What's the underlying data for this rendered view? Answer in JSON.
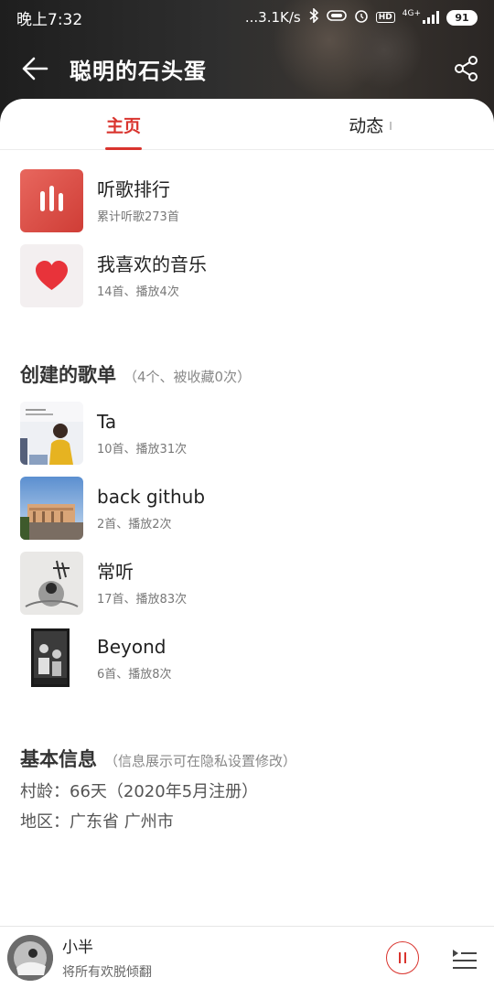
{
  "status_bar": {
    "time": "晚上7:32",
    "network_speed": "...3.1K/s",
    "network_type": "4G+",
    "battery": "91"
  },
  "header": {
    "title": "聪明的石头蛋"
  },
  "tabs": [
    {
      "label": "主页",
      "count": ""
    },
    {
      "label": "动态",
      "count": "I"
    }
  ],
  "top_items": [
    {
      "title": "听歌排行",
      "subtitle": "累计听歌273首",
      "icon": "bar-chart-icon"
    },
    {
      "title": "我喜欢的音乐",
      "subtitle": "14首、播放4次",
      "icon": "heart-icon"
    }
  ],
  "playlists_section": {
    "title": "创建的歌单",
    "note": "（4个、被收藏0次）"
  },
  "playlists": [
    {
      "title": "Ta",
      "subtitle": "10首、播放31次"
    },
    {
      "title": "back github",
      "subtitle": "2首、播放2次"
    },
    {
      "title": "常听",
      "subtitle": "17首、播放83次"
    },
    {
      "title": "Beyond",
      "subtitle": "6首、播放8次"
    }
  ],
  "basic_info": {
    "title": "基本信息",
    "note": "（信息展示可在隐私设置修改）",
    "village_age": "村龄：66天（2020年5月注册）",
    "region": "地区：广东省 广州市"
  },
  "player": {
    "song": "小半",
    "lyric": "将所有欢脱倾翻"
  },
  "colors": {
    "accent": "#d9342e",
    "heart": "#e8333a",
    "rank_tile": "#e0524a"
  }
}
